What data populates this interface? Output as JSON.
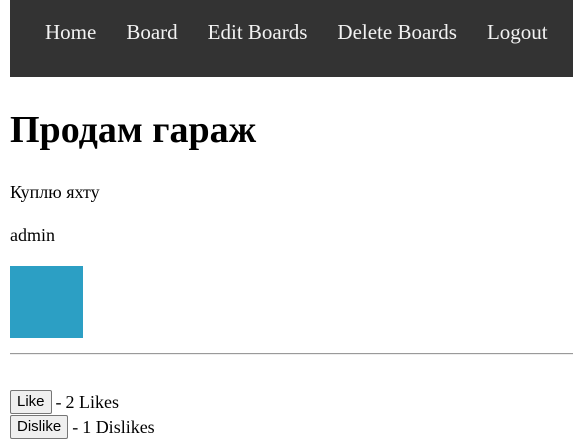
{
  "nav": {
    "items": [
      {
        "label": "Home"
      },
      {
        "label": "Board"
      },
      {
        "label": "Edit Boards"
      },
      {
        "label": "Delete Boards"
      },
      {
        "label": "Logout"
      }
    ]
  },
  "post": {
    "title": "Продам гараж",
    "description": "Куплю яхту",
    "author": "admin",
    "image_color": "#2c9fc4"
  },
  "votes": {
    "like_label": "Like",
    "like_text": "2 Likes",
    "dislike_label": "Dislike",
    "dislike_text": "1 Dislikes",
    "separator": "-"
  }
}
